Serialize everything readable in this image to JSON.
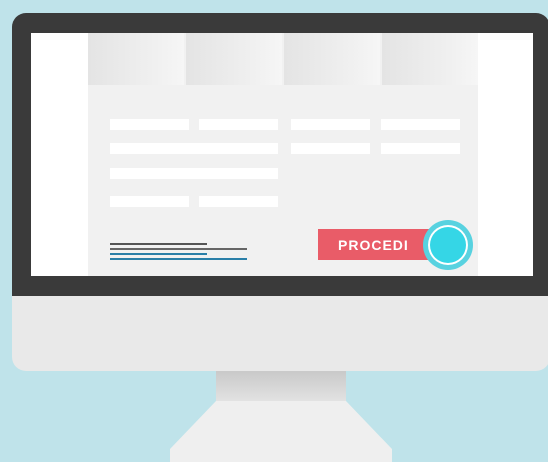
{
  "screen": {
    "proceed_button_label": "PROCEDI"
  },
  "colors": {
    "background": "#bfe3ea",
    "bezel": "#3a3a3a",
    "chin": "#e9e9e9",
    "button": "#e95c68",
    "cursor_ring": "#35d6e6",
    "link_underline": "#2a7fa8"
  },
  "icons": [
    "monitor-icon",
    "click-indicator-icon"
  ]
}
